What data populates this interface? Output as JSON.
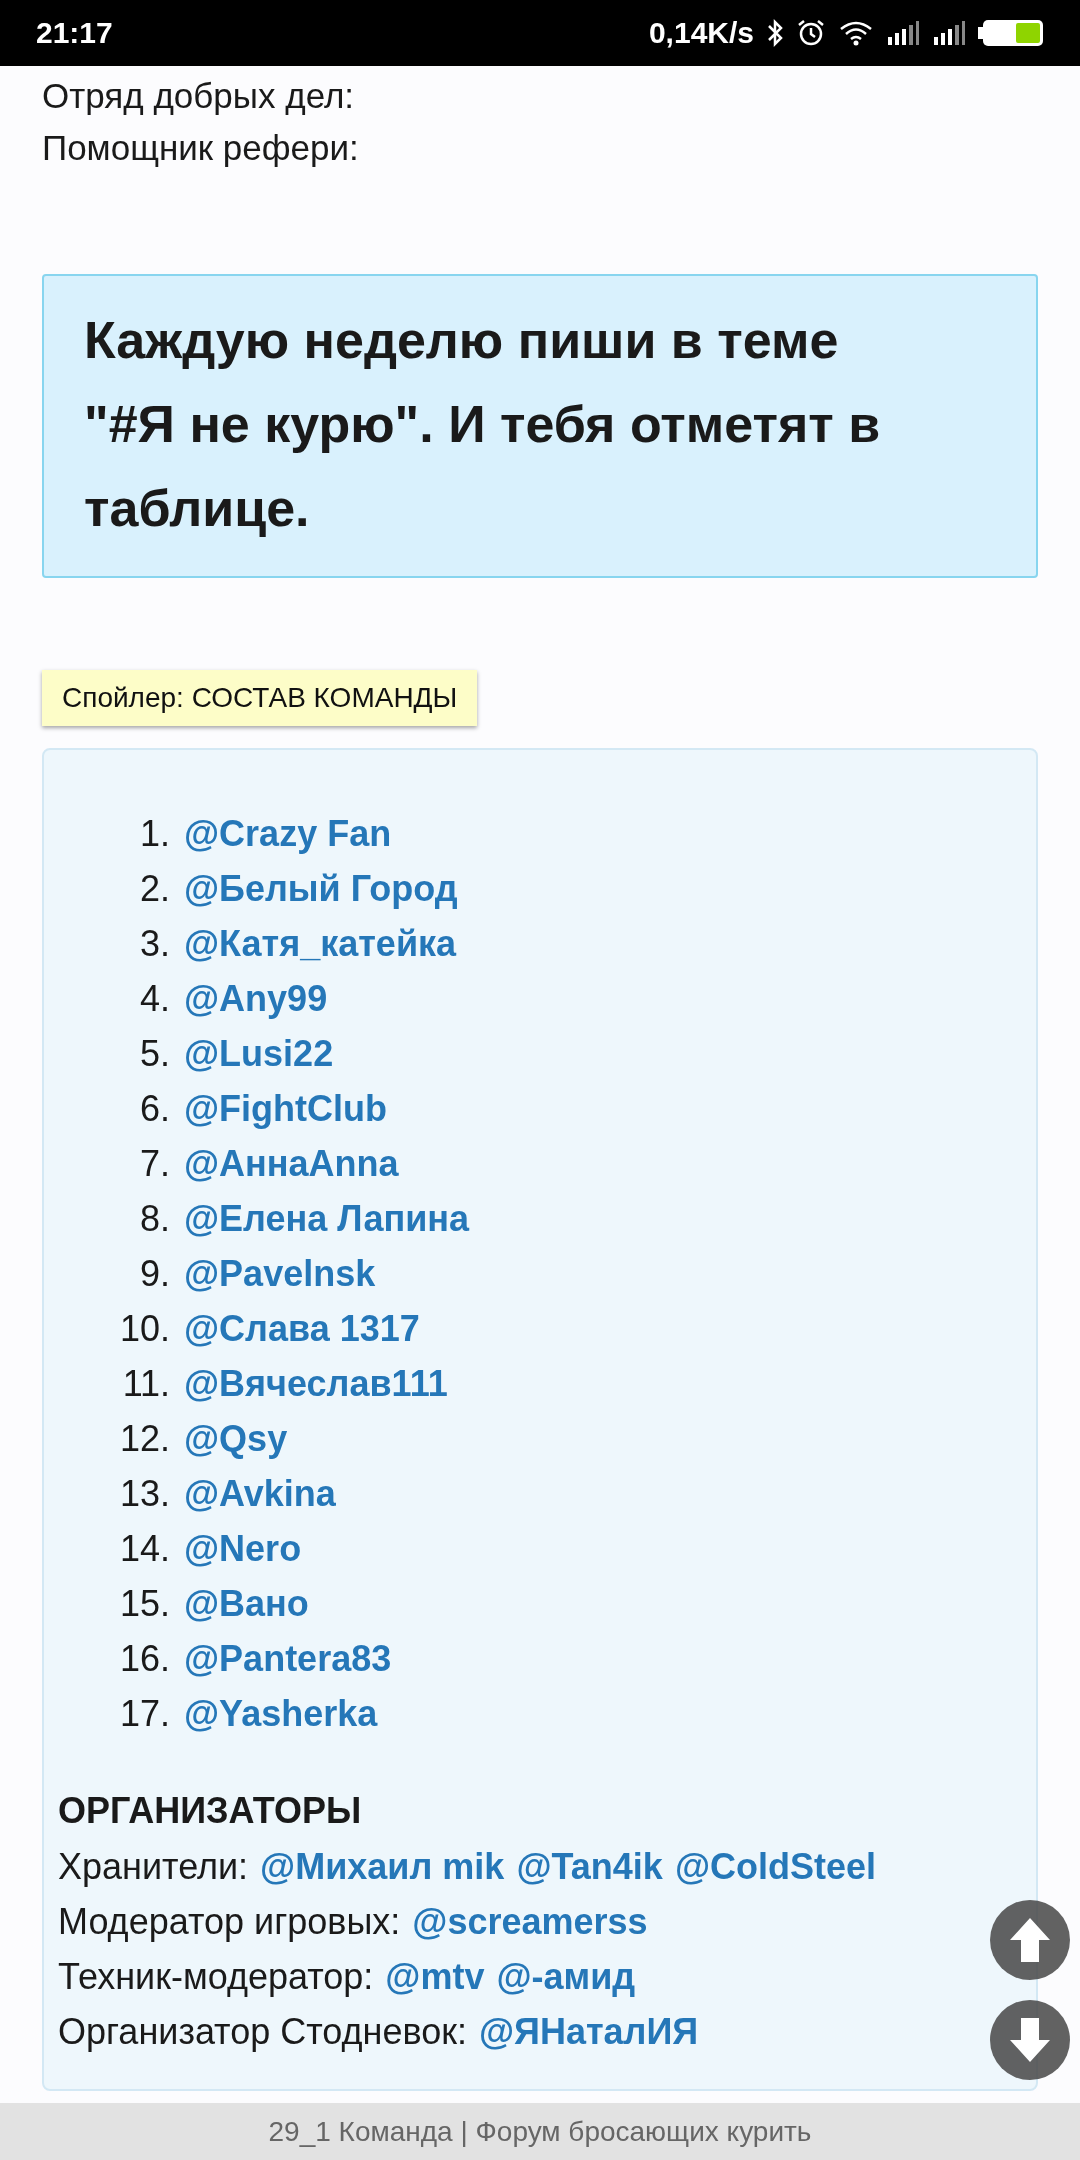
{
  "status_bar": {
    "time": "21:17",
    "network_speed": "0,14K/s"
  },
  "roles": [
    {
      "label": "Отряд добрых дел:"
    },
    {
      "label": "Помощник рефери:"
    }
  ],
  "notice": {
    "text": "Каждую неделю пиши в теме \"#Я не курю\". И тебя отметят в таблице."
  },
  "spoiler": {
    "label": "Спойлер: СОСТАВ КОМАНДЫ"
  },
  "members": [
    {
      "number": "1.",
      "name": "@Crazy Fan"
    },
    {
      "number": "2.",
      "name": "@Белый Город"
    },
    {
      "number": "3.",
      "name": "@Катя_катейка"
    },
    {
      "number": "4.",
      "name": "@Any99"
    },
    {
      "number": "5.",
      "name": "@Lusi22"
    },
    {
      "number": "6.",
      "name": "@FightClub"
    },
    {
      "number": "7.",
      "name": "@АннаAnna"
    },
    {
      "number": "8.",
      "name": "@Елена Лапина"
    },
    {
      "number": "9.",
      "name": "@Pavelnsk"
    },
    {
      "number": "10.",
      "name": "@Слава 1317"
    },
    {
      "number": "11.",
      "name": "@Вячеслав111"
    },
    {
      "number": "12.",
      "name": "@Qsy"
    },
    {
      "number": "13.",
      "name": "@Avkina"
    },
    {
      "number": "14.",
      "name": "@Nero"
    },
    {
      "number": "15.",
      "name": "@Вано"
    },
    {
      "number": "16.",
      "name": "@Pantera83"
    },
    {
      "number": "17.",
      "name": "@Yasherka"
    }
  ],
  "organizers": {
    "title": "ОРГАНИЗАТОРЫ",
    "rows": [
      {
        "label": "Хранители:",
        "links": [
          "@Михаил mik",
          "@Tan4ik",
          "@ColdSteel"
        ]
      },
      {
        "label": "Модератор игровых:",
        "links": [
          "@screamerss"
        ]
      },
      {
        "label": "Техник-модератор:",
        "links": [
          "@mtv",
          "@-амид"
        ]
      },
      {
        "label": "Организатор Стодневок:",
        "links": [
          "@ЯНаталИЯ"
        ]
      }
    ]
  },
  "footer": {
    "title": "29_1 Команда | Форум бросающих курить"
  }
}
